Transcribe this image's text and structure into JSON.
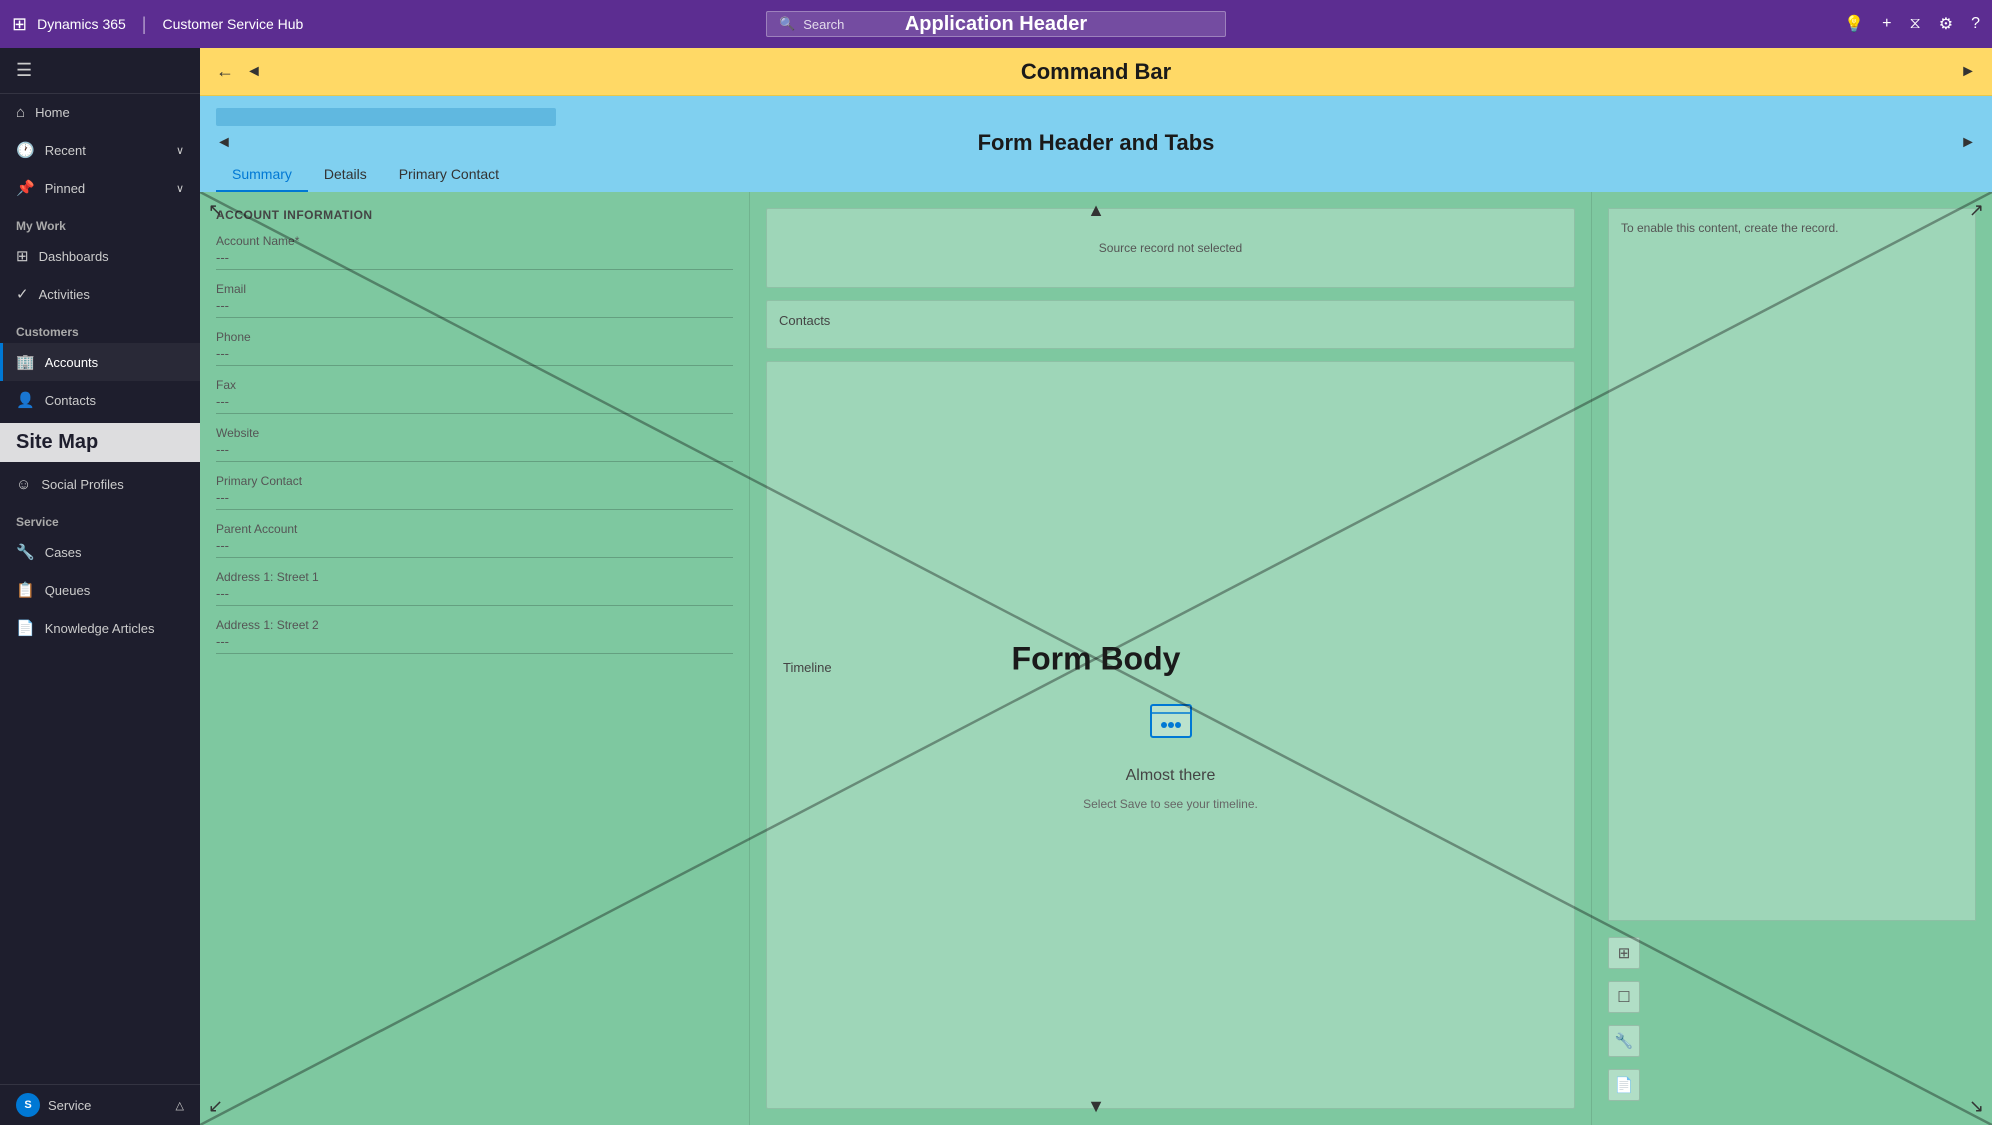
{
  "appHeader": {
    "waffle": "⊞",
    "appName": "Dynamics 365",
    "separator": "|",
    "moduleName": "Customer Service Hub",
    "searchPlaceholder": "Search",
    "title": "Application Header",
    "icons": {
      "lightbulb": "💡",
      "plus": "+",
      "filter": "⧖",
      "settings": "⚙",
      "help": "?"
    }
  },
  "commandBar": {
    "backArrow": "←",
    "leftArrow": "◄",
    "title": "Command Bar",
    "rightArrow": "►"
  },
  "formHeader": {
    "title": "Form Header and Tabs",
    "leftArrow": "◄",
    "rightArrow": "►",
    "tabs": [
      {
        "label": "Summary",
        "active": true
      },
      {
        "label": "Details",
        "active": false
      },
      {
        "label": "Primary Contact",
        "active": false
      }
    ]
  },
  "sidebar": {
    "hamburger": "☰",
    "items": [
      {
        "label": "Home",
        "icon": "⌂",
        "hasChevron": false
      },
      {
        "label": "Recent",
        "icon": "🕐",
        "hasChevron": true
      },
      {
        "label": "Pinned",
        "icon": "📌",
        "hasChevron": true
      }
    ],
    "myWorkLabel": "My Work",
    "myWorkItems": [
      {
        "label": "Dashboards",
        "icon": "⊞"
      },
      {
        "label": "Activities",
        "icon": "✓"
      }
    ],
    "customersLabel": "Customers",
    "customerItems": [
      {
        "label": "Accounts",
        "icon": "🏢",
        "active": true
      },
      {
        "label": "Contacts",
        "icon": "👤"
      },
      {
        "label": "Social Profiles",
        "icon": "☺"
      }
    ],
    "siteMapLabel": "Site Map",
    "serviceLabel": "Service",
    "serviceItems": [
      {
        "label": "Cases",
        "icon": "🔧"
      },
      {
        "label": "Queues",
        "icon": "📋"
      },
      {
        "label": "Knowledge Articles",
        "icon": "📄"
      }
    ],
    "bottom": {
      "avatarInitial": "S",
      "label": "Service",
      "chevron": "△"
    }
  },
  "formBody": {
    "label": "Form Body",
    "leftColumn": {
      "sectionTitle": "ACCOUNT INFORMATION",
      "fields": [
        {
          "label": "Account Name*",
          "value": "---"
        },
        {
          "label": "Email",
          "value": "---"
        },
        {
          "label": "Phone",
          "value": "---"
        },
        {
          "label": "Fax",
          "value": "---"
        },
        {
          "label": "Website",
          "value": "---"
        },
        {
          "label": "Primary Contact",
          "value": "---"
        },
        {
          "label": "Parent Account",
          "value": "---"
        },
        {
          "label": "Address 1: Street 1",
          "value": "---"
        },
        {
          "label": "Address 1: Street 2",
          "value": "---"
        }
      ]
    },
    "middleColumn": {
      "sourcePanel": {
        "message": "Source record not selected"
      },
      "contactsPanel": {
        "title": "Contacts"
      },
      "timelinePanel": {
        "title": "Timeline",
        "almostThere": "Almost there",
        "message": "Select Save to see your timeline."
      }
    },
    "rightColumn": {
      "enableMessage": "To enable this content, create the record.",
      "actions": [
        "⊞",
        "☐",
        "🔧",
        "📄"
      ]
    }
  }
}
